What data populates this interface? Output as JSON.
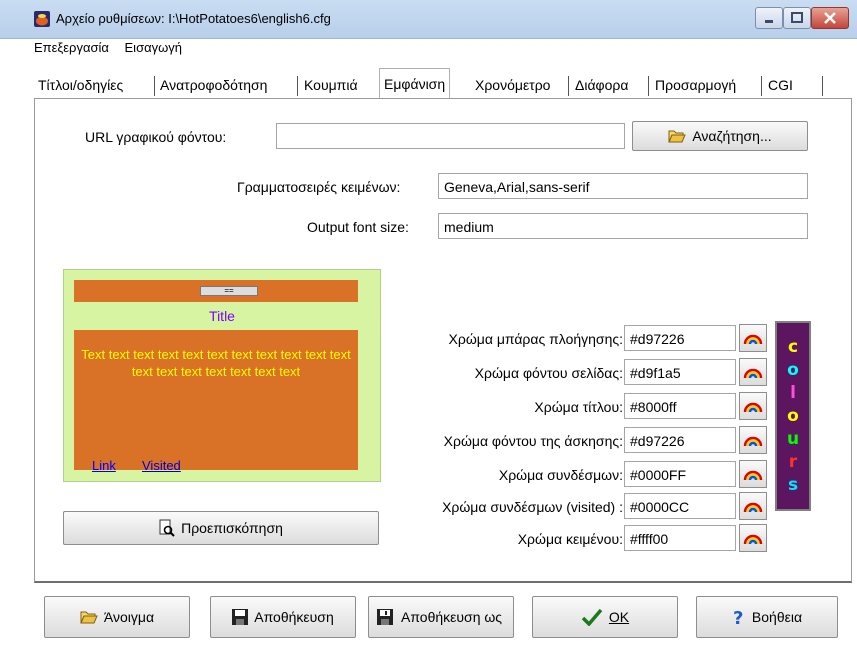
{
  "window": {
    "title": "Αρχείο ρυθμίσεων: I:\\HotPotatoes6\\english6.cfg"
  },
  "menu": [
    "Επεξεργασία",
    "Εισαγωγή"
  ],
  "tabs": [
    {
      "label": "Τίτλοι/οδηγίες"
    },
    {
      "label": "Ανατροφοδότηση"
    },
    {
      "label": "Κουμπιά"
    },
    {
      "label": "Εμφάνιση",
      "active": true
    },
    {
      "label": "Χρονόμετρο"
    },
    {
      "label": "Διάφορα"
    },
    {
      "label": "Προσαρμογή"
    },
    {
      "label": "CGI"
    }
  ],
  "appearance": {
    "bg_image_label": "URL γραφικού φόντου:",
    "bg_image_value": "",
    "browse_label": "Αναζήτηση...",
    "fonts_label": "Γραμματοσειρές κειμένων:",
    "fonts_value": "Geneva,Arial,sans-serif",
    "font_size_label": "Output font size:",
    "font_size_value": "medium"
  },
  "preview": {
    "nav_button": "==",
    "title": "Title",
    "text": "Text text text text text text text text text text text text text text text text text text",
    "link": "Link",
    "visited": "Visited",
    "preview_button": "Προεπισκόπηση"
  },
  "colors": [
    {
      "label": "Χρώμα μπάρας πλοήγησης:",
      "value": "#d97226"
    },
    {
      "label": "Χρώμα φόντου σελίδας:",
      "value": "#d9f1a5"
    },
    {
      "label": "Χρώμα τίτλου:",
      "value": "#8000ff"
    },
    {
      "label": "Χρώμα φόντου της άσκησης:",
      "value": "#d97226"
    },
    {
      "label": "Χρώμα συνδέσμων:",
      "value": "#0000FF"
    },
    {
      "label": "Χρώμα συνδέσμων (visited) :",
      "value": "#0000CC"
    },
    {
      "label": "Χρώμα κειμένου:",
      "value": "#ffff00"
    }
  ],
  "colours_banner": [
    "c",
    "o",
    "l",
    "o",
    "u",
    "r",
    "s"
  ],
  "colours_banner_colors": [
    "#ffff00",
    "#00ffff",
    "#ff4fd8",
    "#ffff00",
    "#00ff00",
    "#ff3030",
    "#00e5ff"
  ],
  "footer": {
    "open": "Άνοιγμα",
    "save": "Αποθήκευση",
    "save_as": "Αποθήκευση ως",
    "ok": "OK",
    "help": "Βοήθεια"
  }
}
